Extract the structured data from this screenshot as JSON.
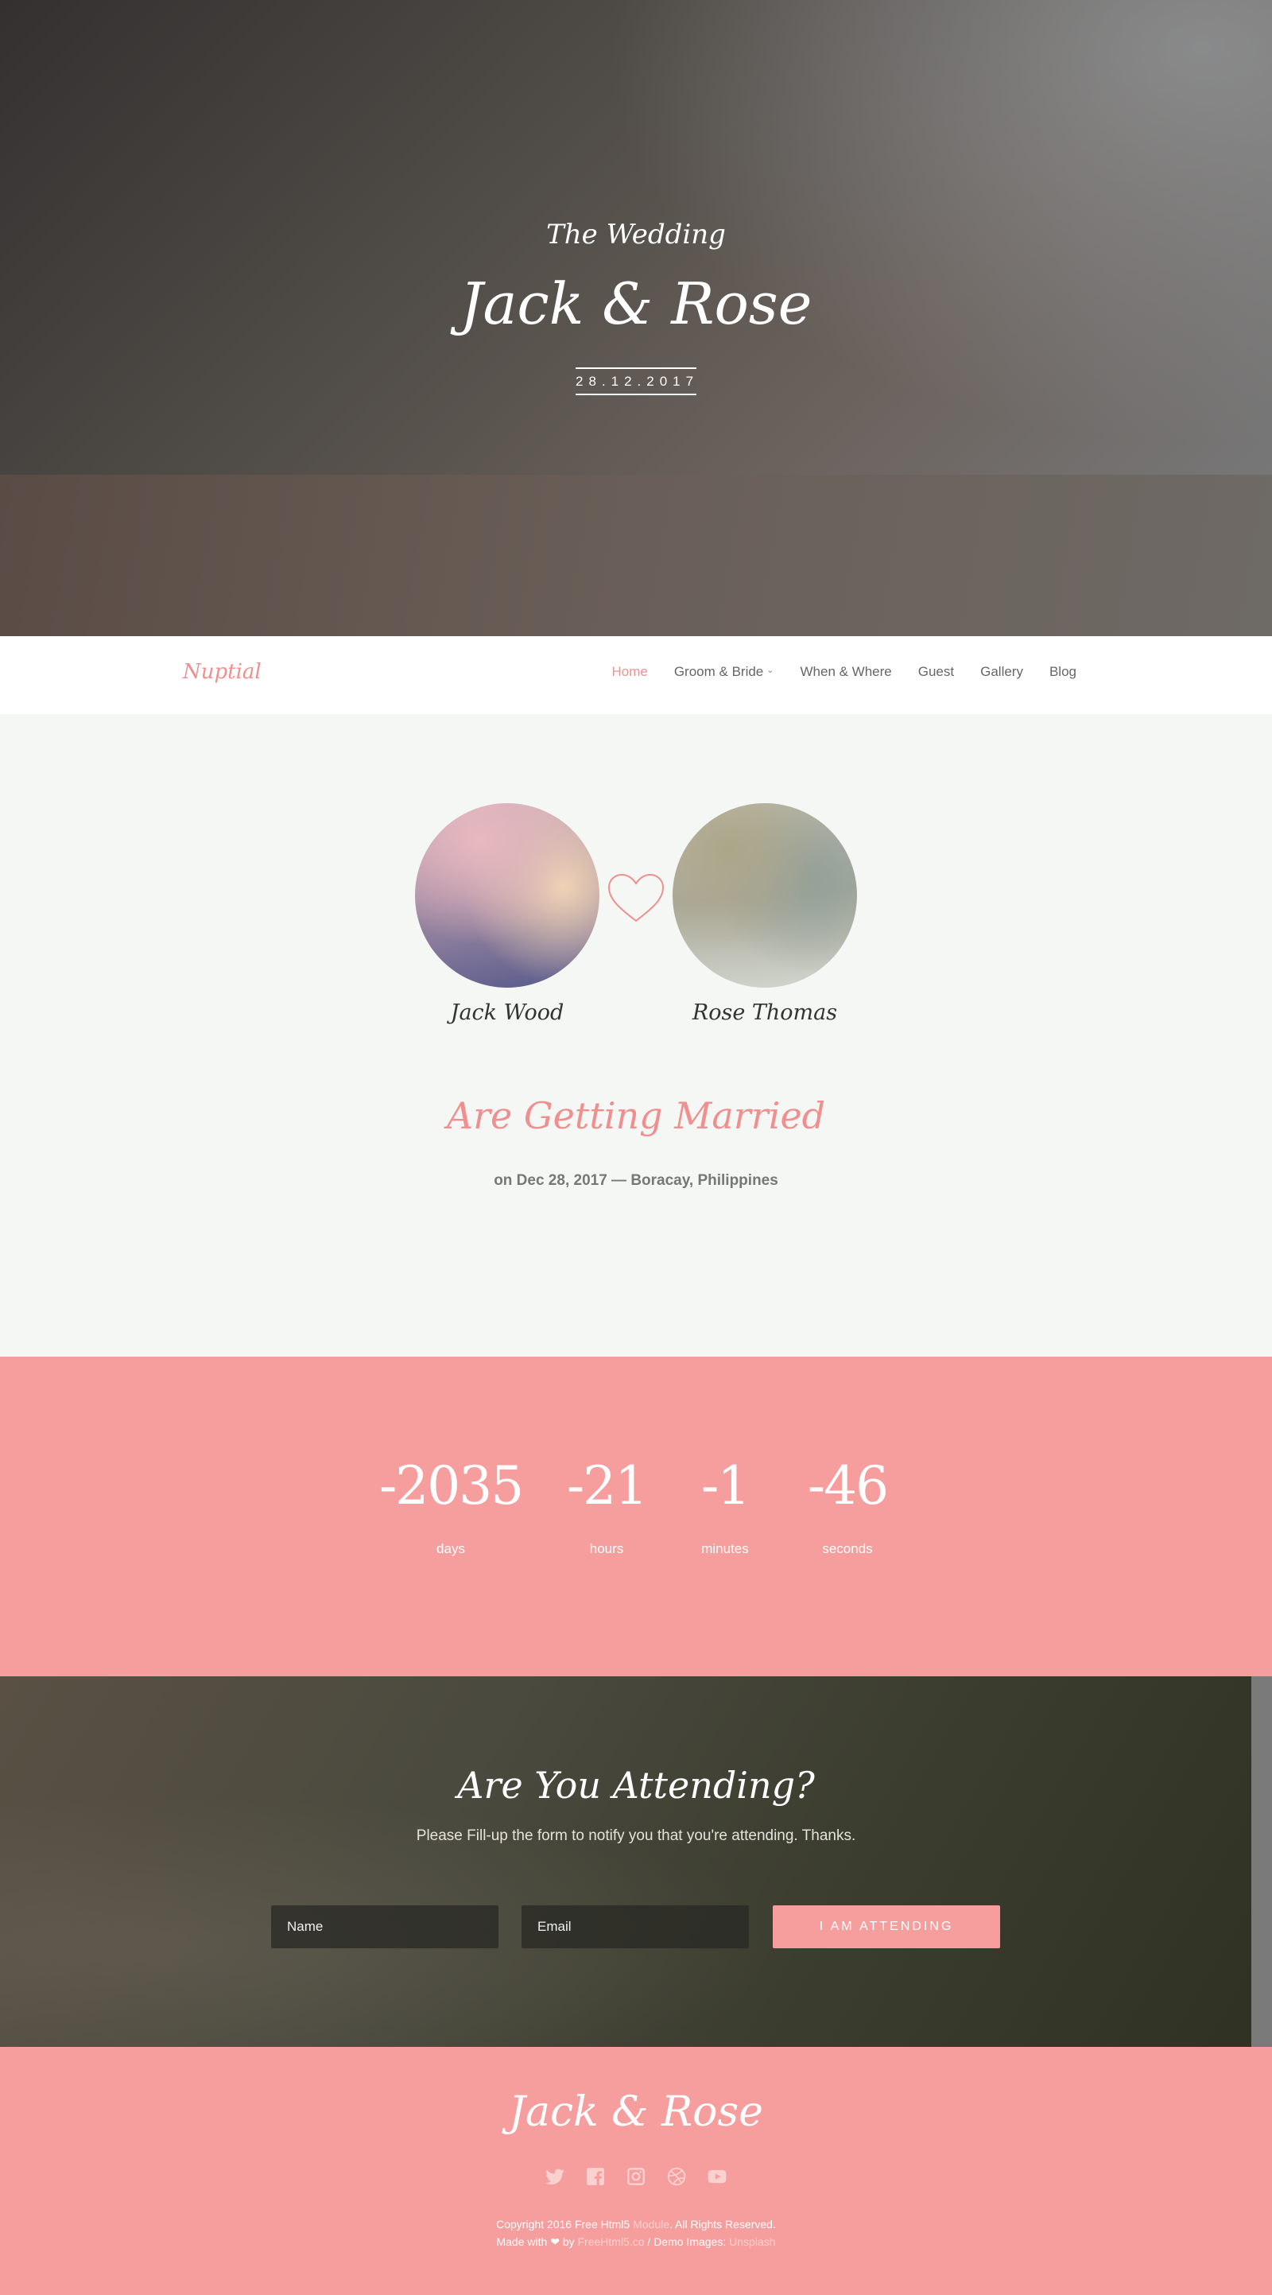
{
  "hero": {
    "pre_title": "The Wedding",
    "title": "Jack & Rose",
    "date": "28.12.2017"
  },
  "nav": {
    "logo": "Nuptial",
    "items": [
      {
        "label": "Home",
        "active": true
      },
      {
        "label": "Groom & Bride",
        "has_dropdown": true
      },
      {
        "label": "When & Where"
      },
      {
        "label": "Guest"
      },
      {
        "label": "Gallery"
      },
      {
        "label": "Blog"
      }
    ]
  },
  "couple": {
    "groom_name": "Jack Wood",
    "bride_name": "Rose Thomas",
    "heading": "Are Getting Married",
    "details": "on Dec 28, 2017 — Boracay, Philippines"
  },
  "countdown": {
    "days": "-2035",
    "days_label": "days",
    "hours": "-21",
    "hours_label": "hours",
    "minutes": "-1",
    "minutes_label": "minutes",
    "seconds": "-46",
    "seconds_label": "seconds"
  },
  "rsvp": {
    "title": "Are You Attending?",
    "subtitle": "Please Fill-up the form to notify you that you're attending. Thanks.",
    "name_placeholder": "Name",
    "email_placeholder": "Email",
    "button_label": "I AM ATTENDING"
  },
  "footer": {
    "title": "Jack & Rose",
    "social_icons": [
      "twitter-icon",
      "facebook-icon",
      "instagram-icon",
      "dribbble-icon",
      "youtube-icon"
    ],
    "copyright_prefix": "Copyright 2016 Free Html5",
    "copyright_link": "Module",
    "copyright_suffix": ". All Rights Reserved.",
    "made_with": "Made with",
    "by": "by",
    "made_by_link": "FreeHtml5.co",
    "demo_images": "/ Demo Images:",
    "demo_link": "Unsplash"
  },
  "colors": {
    "accent": "#f59e9d",
    "accent_text": "#f08f8f"
  }
}
